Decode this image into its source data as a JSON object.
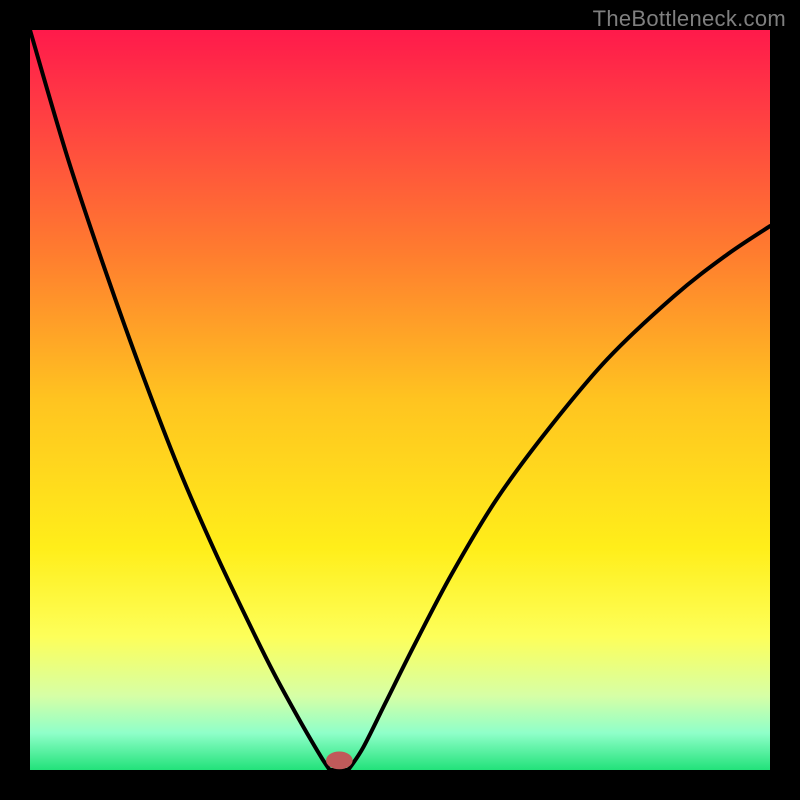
{
  "watermark": "TheBottleneck.com",
  "chart_data": {
    "type": "line",
    "title": "",
    "xlabel": "",
    "ylabel": "",
    "xlim": [
      0,
      1
    ],
    "ylim": [
      0,
      1
    ],
    "background_gradient_stops": [
      {
        "offset": 0.0,
        "color": "#ff1a4b"
      },
      {
        "offset": 0.1,
        "color": "#ff3a44"
      },
      {
        "offset": 0.3,
        "color": "#ff7c2f"
      },
      {
        "offset": 0.5,
        "color": "#ffc420"
      },
      {
        "offset": 0.7,
        "color": "#ffee1a"
      },
      {
        "offset": 0.82,
        "color": "#fdff5a"
      },
      {
        "offset": 0.9,
        "color": "#d6ffa6"
      },
      {
        "offset": 0.95,
        "color": "#8fffc9"
      },
      {
        "offset": 1.0,
        "color": "#22e27a"
      }
    ],
    "series": [
      {
        "name": "left-branch",
        "x": [
          0.0,
          0.05,
          0.1,
          0.15,
          0.2,
          0.25,
          0.3,
          0.33,
          0.36,
          0.38,
          0.395,
          0.405
        ],
        "y": [
          1.0,
          0.83,
          0.68,
          0.54,
          0.41,
          0.295,
          0.19,
          0.13,
          0.075,
          0.04,
          0.015,
          0.0
        ]
      },
      {
        "name": "valley-floor",
        "x": [
          0.405,
          0.43
        ],
        "y": [
          0.0,
          0.0
        ]
      },
      {
        "name": "right-branch",
        "x": [
          0.43,
          0.45,
          0.48,
          0.52,
          0.57,
          0.63,
          0.7,
          0.78,
          0.87,
          0.94,
          1.0
        ],
        "y": [
          0.0,
          0.03,
          0.09,
          0.17,
          0.265,
          0.365,
          0.46,
          0.555,
          0.64,
          0.695,
          0.735
        ]
      }
    ],
    "marker": {
      "name": "tip-marker",
      "cx": 0.418,
      "cy": 0.013,
      "rx": 0.018,
      "ry": 0.012,
      "color": "#c05a5a"
    }
  }
}
